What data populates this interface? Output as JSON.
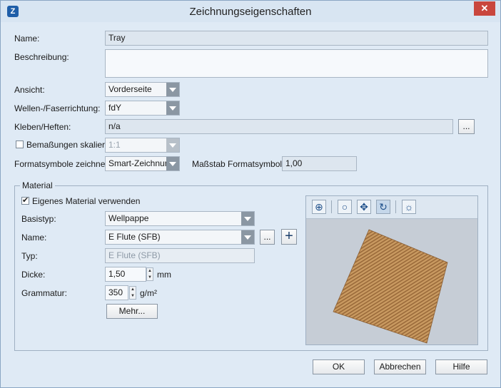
{
  "window": {
    "title": "Zeichnungseigenschaften",
    "close_glyph": "✕",
    "app_icon": "Z"
  },
  "fields": {
    "name_label": "Name:",
    "name_value": "Tray",
    "beschreibung_label": "Beschreibung:",
    "beschreibung_value": "",
    "ansicht_label": "Ansicht:",
    "ansicht_value": "Vorderseite",
    "wellen_label": "Wellen-/Faserrichtung:",
    "wellen_value": "fdY",
    "kleben_label": "Kleben/Heften:",
    "kleben_value": "n/a",
    "kleben_button": "...",
    "bemassungen_label": "Bemaßungen skalieren",
    "bemassungen_checked": false,
    "bemassungen_value": "1:1",
    "formatsymbole_label": "Formatsymbole zeichnen:",
    "formatsymbole_value": "Smart-Zeichnung",
    "massstab_label": "Maßstab Formatsymbole:",
    "massstab_value": "1,00"
  },
  "material": {
    "group_title": "Material",
    "eigenes_label": "Eigenes Material verwenden",
    "eigenes_checked": true,
    "basistyp_label": "Basistyp:",
    "basistyp_value": "Wellpappe",
    "name_label": "Name:",
    "name_value": "E Flute (SFB)",
    "name_more_button": "...",
    "name_add_button": "+",
    "typ_label": "Typ:",
    "typ_value": "E Flute (SFB)",
    "dicke_label": "Dicke:",
    "dicke_value": "1,50",
    "dicke_unit": "mm",
    "grammatur_label": "Grammatur:",
    "grammatur_value": "350",
    "grammatur_unit": "g/m²",
    "mehr_button": "Mehr...",
    "preview_toolbar": [
      "zoom-fit-icon",
      "zoom-icon",
      "pan-icon",
      "rotate-icon",
      "light-icon"
    ],
    "sample_color": "#c9955c"
  },
  "buttons": {
    "ok": "OK",
    "abbrechen": "Abbrechen",
    "hilfe": "Hilfe"
  }
}
